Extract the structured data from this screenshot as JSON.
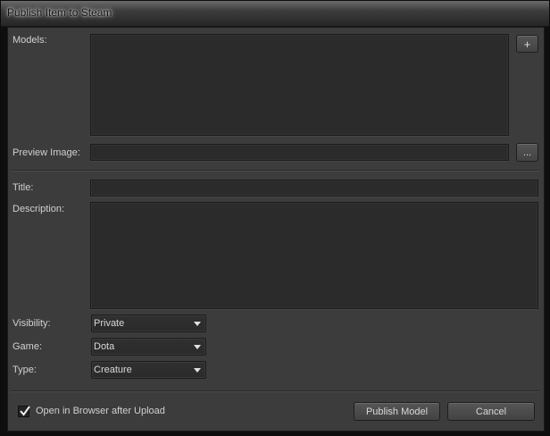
{
  "window": {
    "title": "Publish Item to Steam"
  },
  "models": {
    "label": "Models:",
    "add_label": "+"
  },
  "preview": {
    "label": "Preview Image:",
    "value": "",
    "browse_label": "..."
  },
  "title_field": {
    "label": "Title:",
    "value": ""
  },
  "description": {
    "label": "Description:",
    "value": ""
  },
  "visibility": {
    "label": "Visibility:",
    "selected": "Private"
  },
  "game": {
    "label": "Game:",
    "selected": "Dota"
  },
  "type": {
    "label": "Type:",
    "selected": "Creature"
  },
  "footer": {
    "open_browser_label": "Open in Browser after Upload",
    "open_browser_checked": true,
    "publish_label": "Publish Model",
    "cancel_label": "Cancel"
  },
  "icons": {
    "checkbox": "checkmark-icon",
    "dropdown": "chevron-down-icon"
  }
}
